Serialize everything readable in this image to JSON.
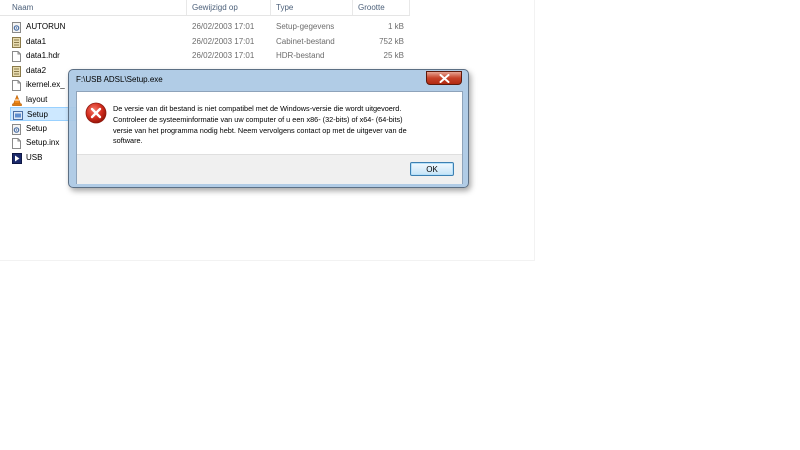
{
  "explorer": {
    "columns": {
      "name": "Naam",
      "date": "Gewijzigd op",
      "type": "Type",
      "size": "Grootte"
    },
    "files": [
      {
        "name": "AUTORUN",
        "date": "26/02/2003 17:01",
        "type": "Setup-gegevens",
        "size": "1 kB",
        "icon": "settings-file-icon"
      },
      {
        "name": "data1",
        "date": "26/02/2003 17:01",
        "type": "Cabinet-bestand",
        "size": "752 kB",
        "icon": "cabinet-file-icon"
      },
      {
        "name": "data1.hdr",
        "date": "26/02/2003 17:01",
        "type": "HDR-bestand",
        "size": "25 kB",
        "icon": "blank-file-icon"
      },
      {
        "name": "data2",
        "date": "",
        "type": "",
        "size": "",
        "icon": "cabinet-file-icon"
      },
      {
        "name": "ikernel.ex_",
        "date": "",
        "type": "",
        "size": "",
        "icon": "blank-file-icon"
      },
      {
        "name": "layout",
        "date": "",
        "type": "",
        "size": "",
        "icon": "vlc-cone-icon"
      },
      {
        "name": "Setup",
        "date": "",
        "type": "",
        "size": "",
        "icon": "setup-app-icon"
      },
      {
        "name": "Setup",
        "date": "",
        "type": "",
        "size": "",
        "icon": "settings-file-icon"
      },
      {
        "name": "Setup.inx",
        "date": "",
        "type": "",
        "size": "",
        "icon": "blank-file-icon"
      },
      {
        "name": "USB",
        "date": "",
        "type": "",
        "size": "",
        "icon": "play-shortcut-icon"
      }
    ]
  },
  "dialog": {
    "title": "F:\\USB ADSL\\Setup.exe",
    "message_lines": [
      "De versie van dit bestand is niet compatibel met de Windows-versie die wordt uitgevoerd.",
      "Controleer de systeeminformatie van uw computer of u een x86- (32-bits) of x64- (64-bits)",
      "versie van het programma nodig hebt. Neem vervolgens contact op met de uitgever van de",
      "software."
    ],
    "ok_label": "OK",
    "icon": "error-icon"
  },
  "colors": {
    "selection": "#cde8ff",
    "error_red": "#d42d1f",
    "close_red": "#c7432a"
  }
}
